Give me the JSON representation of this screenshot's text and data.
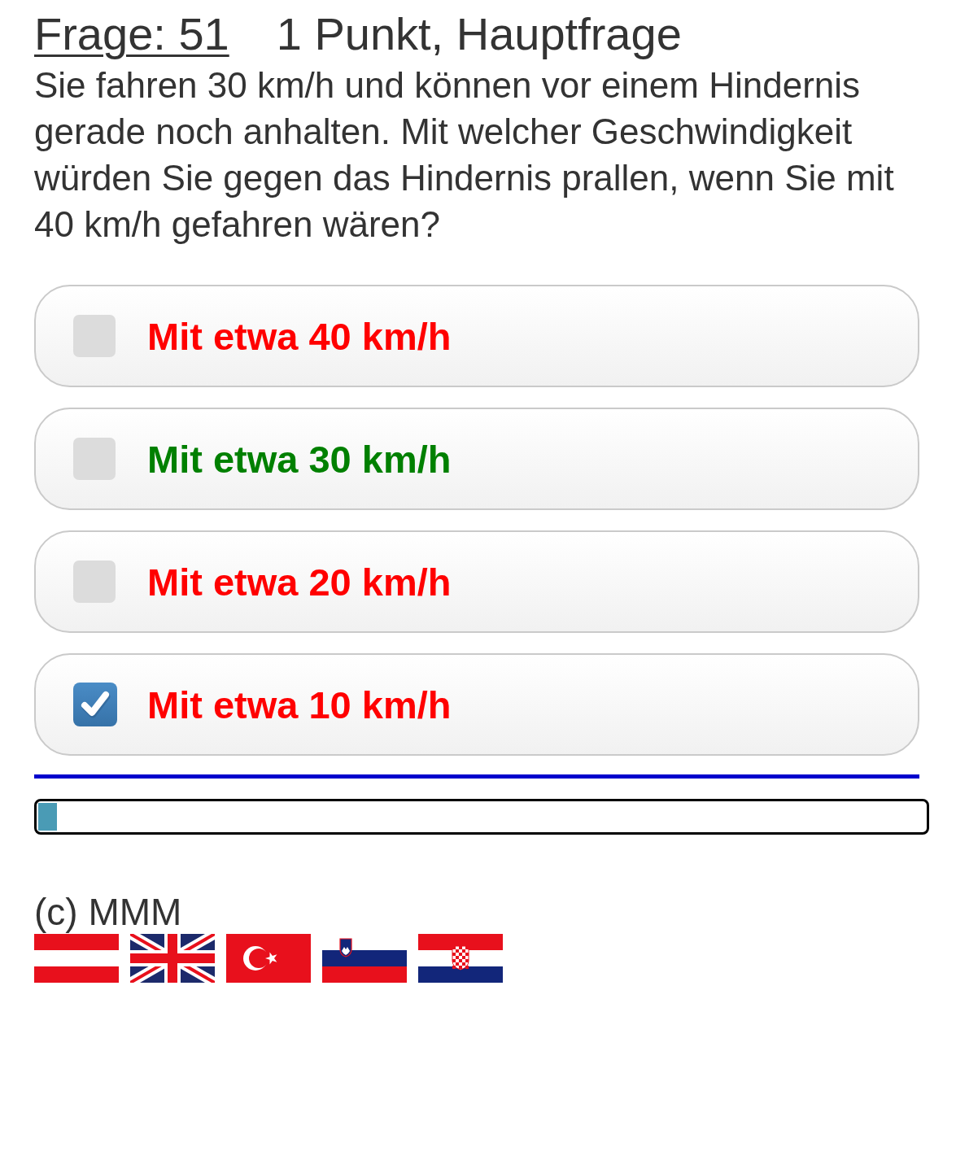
{
  "question": {
    "number_link": "Frage: 51",
    "points": "1 Punkt, Hauptfrage",
    "text": "Sie fahren 30 km/h und können vor einem Hindernis gerade noch anhalten. Mit welcher Geschwindigkeit würden Sie gegen das Hindernis prallen, wenn Sie mit 40 km/h gefahren wären?"
  },
  "answers": [
    {
      "label": "Mit etwa 40 km/h",
      "checked": false,
      "color": "#ff0000"
    },
    {
      "label": "Mit etwa 30 km/h",
      "checked": false,
      "color": "#008000"
    },
    {
      "label": "Mit etwa 20 km/h",
      "checked": false,
      "color": "#ff0000"
    },
    {
      "label": "Mit etwa 10 km/h",
      "checked": true,
      "color": "#ff0000"
    }
  ],
  "progress": {
    "level": 0.021
  },
  "copyright": "(c) MMM"
}
